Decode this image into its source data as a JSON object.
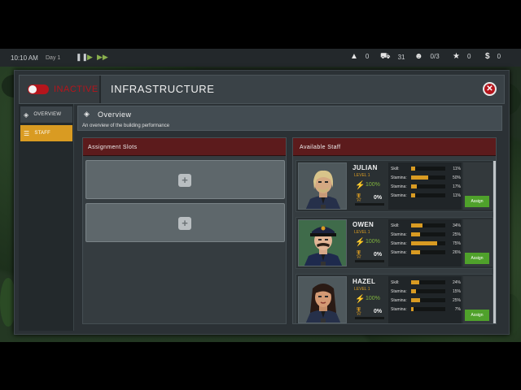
{
  "topbar": {
    "time": "10:10 AM",
    "day": "Day 1",
    "stats": [
      {
        "icon": "warning-icon",
        "glyph": "▲",
        "value": "0"
      },
      {
        "icon": "car-icon",
        "glyph": "⛟",
        "value": "31"
      },
      {
        "icon": "officers-icon",
        "glyph": "☻",
        "value": "0/3"
      },
      {
        "icon": "star-icon",
        "glyph": "★",
        "value": "0"
      },
      {
        "icon": "money-icon",
        "glyph": "$",
        "value": "0"
      }
    ]
  },
  "header": {
    "status": "INACTIVE",
    "title": "INFRASTRUCTURE",
    "close_glyph": "✕"
  },
  "sidebar": {
    "items": [
      {
        "label": "OVERVIEW",
        "glyph": "◈"
      },
      {
        "label": "STAFF",
        "glyph": "☰"
      }
    ]
  },
  "overview": {
    "title": "Overview",
    "subtitle": "An overview of the building performance",
    "glyph": "◈"
  },
  "slots": {
    "heading": "Assignment Slots",
    "plus_glyph": "+"
  },
  "staff": {
    "heading": "Available Staff",
    "assign_label": "Assign",
    "members": [
      {
        "name": "JULIAN",
        "level": "LEVEL 1",
        "morale": "100%",
        "xp": "0%",
        "stats": [
          {
            "label": "Skill:",
            "value": "11%",
            "fill": 0.11
          },
          {
            "label": "Stamina:",
            "value": "50%",
            "fill": 0.5
          },
          {
            "label": "Stamina:",
            "value": "17%",
            "fill": 0.17
          },
          {
            "label": "Stamina:",
            "value": "11%",
            "fill": 0.11
          }
        ]
      },
      {
        "name": "OWEN",
        "level": "LEVEL 1",
        "morale": "100%",
        "xp": "0%",
        "stats": [
          {
            "label": "Skill:",
            "value": "34%",
            "fill": 0.34
          },
          {
            "label": "Stamina:",
            "value": "25%",
            "fill": 0.25
          },
          {
            "label": "Stamina:",
            "value": "75%",
            "fill": 0.75
          },
          {
            "label": "Stamina:",
            "value": "26%",
            "fill": 0.26
          }
        ]
      },
      {
        "name": "HAZEL",
        "level": "LEVEL 1",
        "morale": "100%",
        "xp": "0%",
        "stats": [
          {
            "label": "Skill:",
            "value": "24%",
            "fill": 0.24
          },
          {
            "label": "Stamina:",
            "value": "15%",
            "fill": 0.15
          },
          {
            "label": "Stamina:",
            "value": "25%",
            "fill": 0.25
          },
          {
            "label": "Stamina:",
            "value": "7%",
            "fill": 0.07
          }
        ]
      }
    ]
  },
  "colors": {
    "accent": "#d99b22",
    "danger": "#b5151c",
    "positive": "#4fa12b"
  }
}
